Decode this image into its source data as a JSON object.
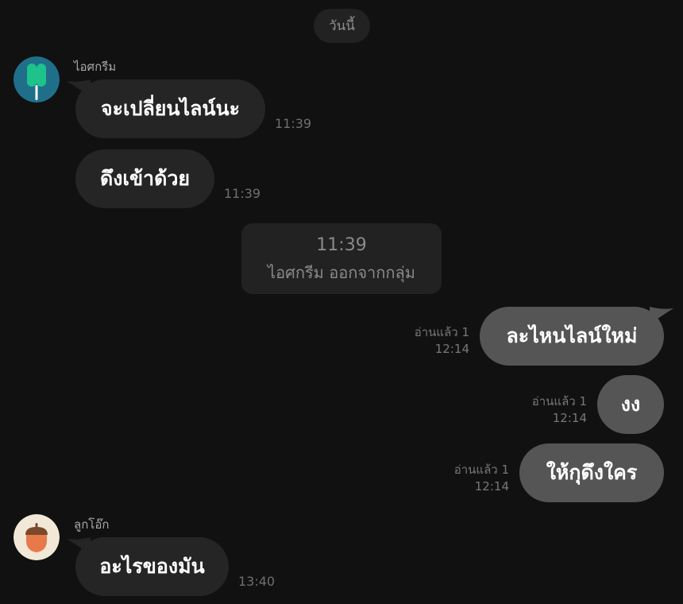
{
  "date_divider": "วันนี้",
  "colors": {
    "background": "#111111",
    "incoming_bubble": "#252525",
    "outgoing_bubble": "#555555",
    "icecream_avatar_bg": "#1f6f8a",
    "icecream_avatar_fg": "#1ec28b",
    "acorn_avatar_bg": "#f2e8d8",
    "acorn_avatar_fg": "#e8794a"
  },
  "contacts": {
    "icecream": {
      "name": "ไอศกรีม",
      "avatar_icon": "popsicle-icon"
    },
    "acorn": {
      "name": "ลูกโอ๊ก",
      "avatar_icon": "acorn-icon"
    }
  },
  "messages": [
    {
      "text": "จะเปลี่ยนไลน์นะ",
      "time": "11:39"
    },
    {
      "text": "ดึงเข้าด้วย",
      "time": "11:39"
    },
    {
      "text": "ละไหนไลน์ใหม่",
      "read": "อ่านแล้ว 1",
      "time": "12:14"
    },
    {
      "text": "งง",
      "read": "อ่านแล้ว 1",
      "time": "12:14"
    },
    {
      "text": "ให้กุดึงใคร",
      "read": "อ่านแล้ว 1",
      "time": "12:14"
    },
    {
      "text": "อะไรของมัน",
      "time": "13:40"
    }
  ],
  "system_notice": {
    "time": "11:39",
    "text": "ไอศกรีม ออกจากกลุ่ม"
  }
}
